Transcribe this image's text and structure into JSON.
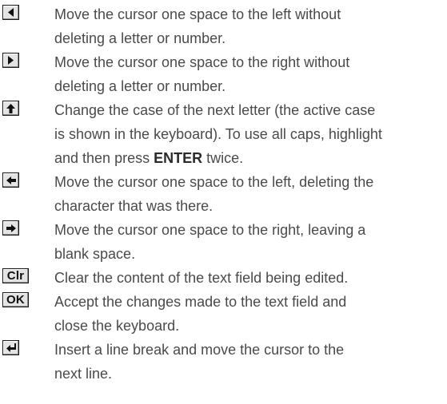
{
  "rows": [
    {
      "icon": "left-triangle-icon",
      "lines": [
        "Move the cursor one space to the left without",
        "deleting a letter or number."
      ]
    },
    {
      "icon": "right-triangle-icon",
      "lines": [
        "Move the cursor one space to the right without",
        "deleting a letter or number."
      ]
    },
    {
      "icon": "up-arrow-icon",
      "lines": [
        "Change the case of the next letter (the active case",
        "is shown in the keyboard). To use all caps, highlight"
      ],
      "line3_pre": "and then press ",
      "line3_bold": "ENTER",
      "line3_post": " twice."
    },
    {
      "icon": "left-arrow-icon",
      "lines": [
        "Move the cursor one space to the left, deleting the",
        "character that was there."
      ]
    },
    {
      "icon": "right-arrow-icon",
      "lines": [
        "Move the cursor one space to the right, leaving a",
        "blank space."
      ]
    },
    {
      "icon_label": "Clr",
      "lines": [
        "Clear the content of the text field being edited."
      ]
    },
    {
      "icon_label": "OK",
      "lines": [
        "Accept the changes made to the text field and",
        "close the keyboard."
      ]
    },
    {
      "icon": "return-arrow-icon",
      "lines": [
        "Insert a line break and move the cursor to the",
        "next line."
      ]
    }
  ]
}
